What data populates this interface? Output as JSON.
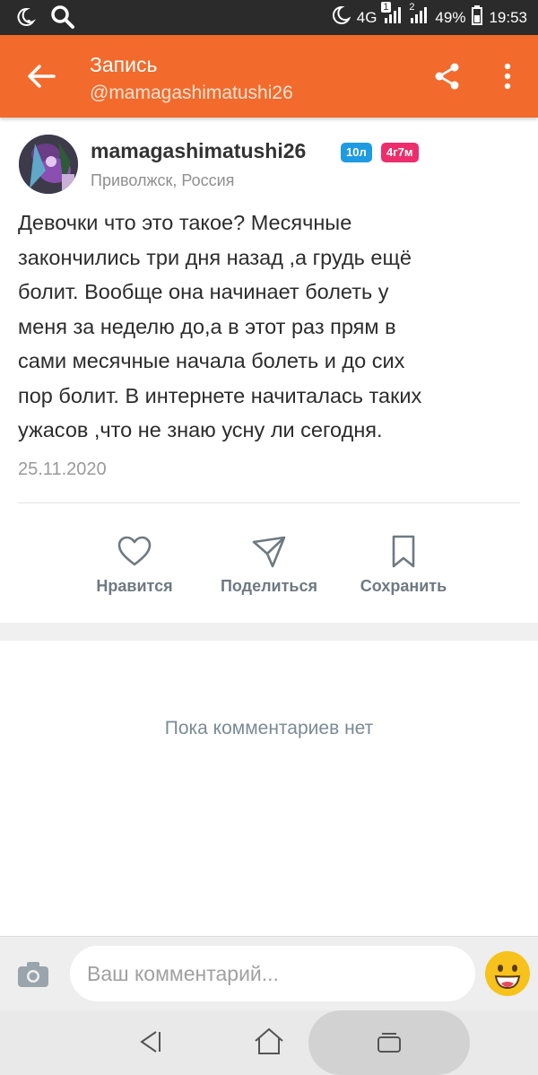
{
  "status_bar": {
    "network": "4G",
    "sim1_indicator": "1",
    "sim2_indicator": "2",
    "battery": "49%",
    "time": "19:53"
  },
  "toolbar": {
    "title": "Запись",
    "subtitle": "@mamagashimatushi26",
    "icons": {
      "back": "arrow-left-icon",
      "share": "share-icon",
      "more": "more-vertical-icon"
    }
  },
  "post": {
    "username": "mamagashimatushi26",
    "age_badge": "10л",
    "time_badge": "4г7м",
    "location": "Приволжск, Россия",
    "text": "Девочки что это  такое? Месячные\nзакончились три дня назад ,а грудь ещё\nболит. Вообще она начинает болеть у\nменя за неделю до,а в этот раз прям в\nсами месячные начала болеть и до сих\nпор болит. В интернете начиталась таких\nужасов ,что не знаю усну ли сегодня.",
    "date": "25.11.2020"
  },
  "actions": {
    "like_label": "Нравится",
    "share_label": "Поделиться",
    "save_label": "Сохранить"
  },
  "comments": {
    "empty_text": "Пока комментариев нет"
  },
  "comment_bar": {
    "placeholder": "Ваш комментарий..."
  },
  "colors": {
    "toolbar": "#f26a2c",
    "status_bar": "#2b2b2b",
    "age_badge": "#1f9be3",
    "time_badge": "#ec2e6c"
  }
}
